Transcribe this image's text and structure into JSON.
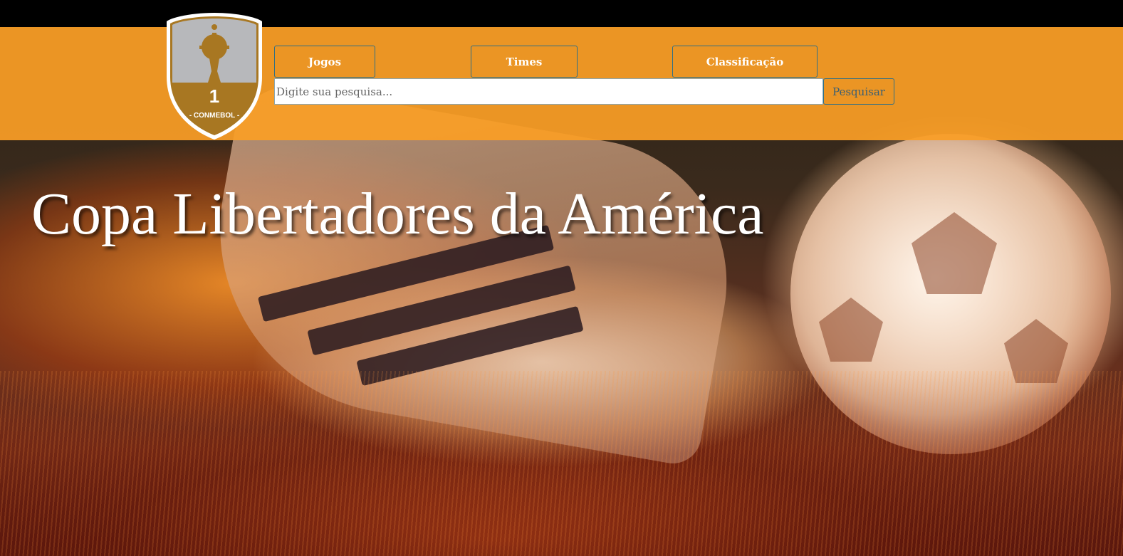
{
  "colors": {
    "header_bg": "#fa9e26",
    "top_bar": "#000000",
    "button_border": "#2f6f86",
    "shield_gold": "#a87722",
    "shield_silver": "#b7b8bb"
  },
  "logo": {
    "number": "1",
    "label": "- CONMEBOL -",
    "icon": "trophy-icon"
  },
  "nav": {
    "items": [
      {
        "label": "Jogos"
      },
      {
        "label": "Times"
      },
      {
        "label": "Classificação"
      }
    ]
  },
  "search": {
    "placeholder": "Digite sua pesquisa...",
    "value": "",
    "button_label": "Pesquisar"
  },
  "hero": {
    "title": "Copa Libertadores da América"
  }
}
